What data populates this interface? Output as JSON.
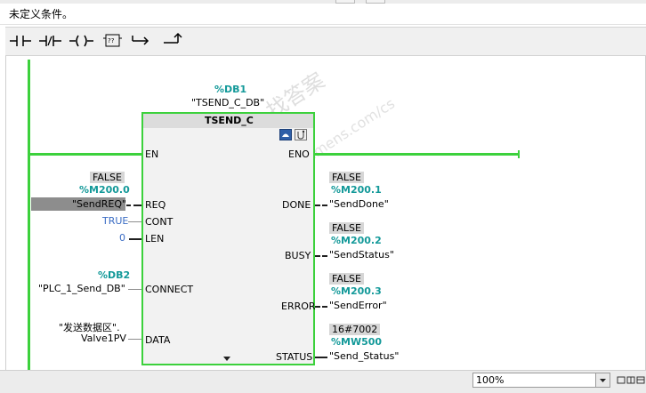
{
  "network": {
    "title": "未定义条件。"
  },
  "toolbar": {
    "buttons": [
      {
        "name": "normally-open-contact-icon"
      },
      {
        "name": "normally-closed-contact-icon"
      },
      {
        "name": "output-coil-icon"
      },
      {
        "name": "empty-box-icon",
        "label": "??"
      },
      {
        "name": "open-branch-icon"
      },
      {
        "name": "close-branch-icon"
      }
    ]
  },
  "instance": {
    "db_address": "%DB1",
    "db_name": "\"TSEND_C_DB\"",
    "block_name": "TSEND_C"
  },
  "inputs": {
    "en": {
      "pin": "EN"
    },
    "req": {
      "pin": "REQ",
      "status": "FALSE",
      "address": "%M200.0",
      "tag": "\"SendREQ\""
    },
    "cont": {
      "pin": "CONT",
      "value": "TRUE"
    },
    "len": {
      "pin": "LEN",
      "value": "0"
    },
    "connect": {
      "pin": "CONNECT",
      "address": "%DB2",
      "tag": "\"PLC_1_Send_DB\""
    },
    "data": {
      "pin": "DATA",
      "tag_line1": "\"发送数据区\".",
      "tag_line2": "Valve1PV"
    }
  },
  "outputs": {
    "eno": {
      "pin": "ENO"
    },
    "done": {
      "pin": "DONE",
      "status": "FALSE",
      "address": "%M200.1",
      "tag": "\"SendDone\""
    },
    "busy": {
      "pin": "BUSY",
      "status": "FALSE",
      "address": "%M200.2",
      "tag": "\"SendStatus\""
    },
    "error": {
      "pin": "ERROR",
      "status": "FALSE",
      "address": "%M200.3",
      "tag": "\"SendError\""
    },
    "status": {
      "pin": "STATUS",
      "status": "16#7002",
      "address": "%MW500",
      "tag": "\"Send_Status\""
    }
  },
  "watermark": {
    "line1": "西门子工业 找答案",
    "line2": "support.industry.siemens.com/cs"
  },
  "statusbar": {
    "zoom": "100%"
  },
  "colors": {
    "power_flow": "#3cd13c",
    "address": "#139999",
    "constant": "#3a6cc4"
  }
}
